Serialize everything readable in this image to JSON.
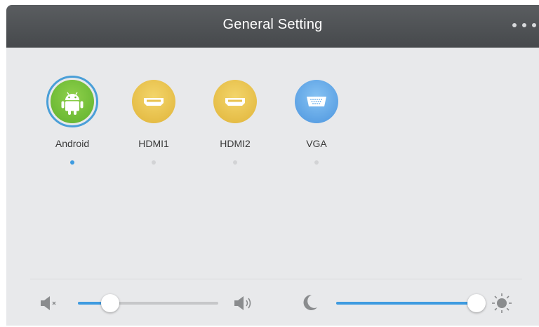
{
  "header": {
    "title": "General Setting",
    "menu_icon": "more-dots-icon"
  },
  "sources": [
    {
      "label": "Android",
      "icon": "android-icon",
      "color": "#6cbd36",
      "selected": true
    },
    {
      "label": "HDMI1",
      "icon": "hdmi-port-icon",
      "color": "#e8c24f",
      "selected": false
    },
    {
      "label": "HDMI2",
      "icon": "hdmi-port-icon",
      "color": "#e8c24f",
      "selected": false
    },
    {
      "label": "VGA",
      "icon": "vga-port-icon",
      "color": "#5ea7e8",
      "selected": false
    }
  ],
  "volume": {
    "value": 0.23,
    "min_icon": "volume-mute-icon",
    "max_icon": "volume-up-icon"
  },
  "brightness": {
    "value": 1.0,
    "min_icon": "moon-icon",
    "max_icon": "sun-icon"
  },
  "colors": {
    "accent": "#3e9be0",
    "titlebar": "#4f5255",
    "panel": "#e8e9eb"
  }
}
